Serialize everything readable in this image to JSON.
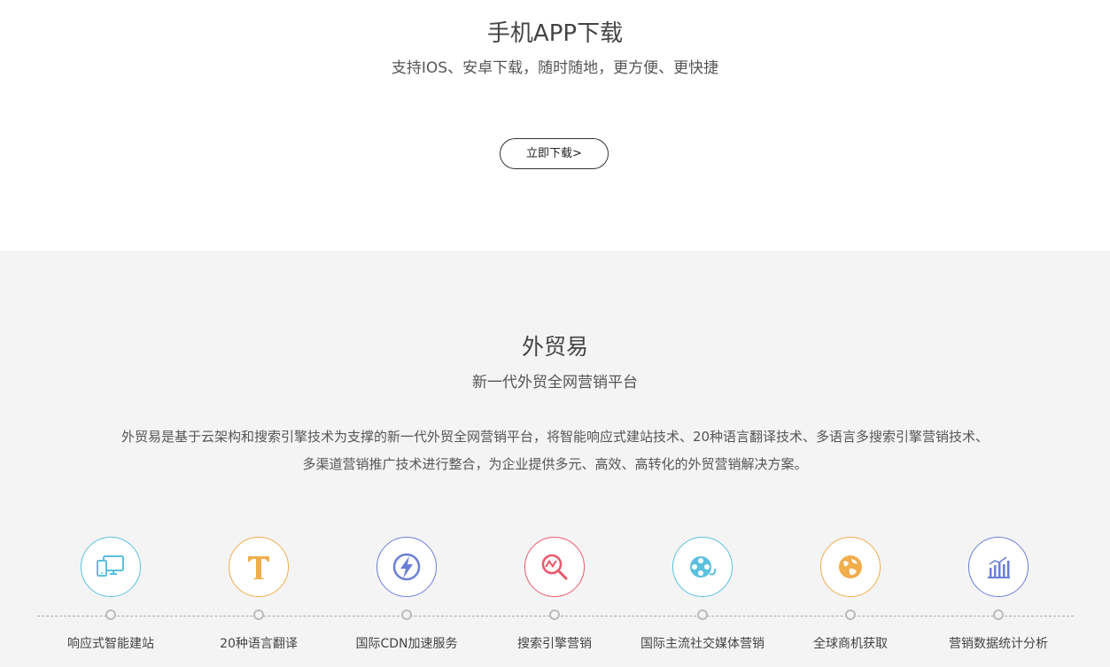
{
  "app_section": {
    "title": "手机APP下载",
    "subtitle": "支持IOS、安卓下载，随时随地，更方便、更快捷",
    "download_button": "立即下载>"
  },
  "waimaoyi_section": {
    "title": "外贸易",
    "subtitle": "新一代外贸全网营销平台",
    "description": "外贸易是基于云架构和搜索引擎技术为支撑的新一代外贸全网营销平台，将智能响应式建站技术、20种语言翻译技术、多语言多搜索引擎营销技术、多渠道营销推广技术进行整合，为企业提供多元、高效、高转化的外贸营销解决方案。",
    "features": [
      {
        "label": "响应式智能建站",
        "icon": "responsive-devices-icon",
        "color": "#5bc0de"
      },
      {
        "label": "20种语言翻译",
        "icon": "font-translate-icon",
        "color": "#f0ad4e"
      },
      {
        "label": "国际CDN加速服务",
        "icon": "lightning-icon",
        "color": "#6b7fd7"
      },
      {
        "label": "搜索引擎营销",
        "icon": "search-trend-icon",
        "color": "#e8596b"
      },
      {
        "label": "国际主流社交媒体营销",
        "icon": "film-reel-icon",
        "color": "#5bc0de"
      },
      {
        "label": "全球商机获取",
        "icon": "globe-icon",
        "color": "#f0ad4e"
      },
      {
        "label": "营销数据统计分析",
        "icon": "bar-chart-icon",
        "color": "#6b7fd7"
      }
    ]
  }
}
